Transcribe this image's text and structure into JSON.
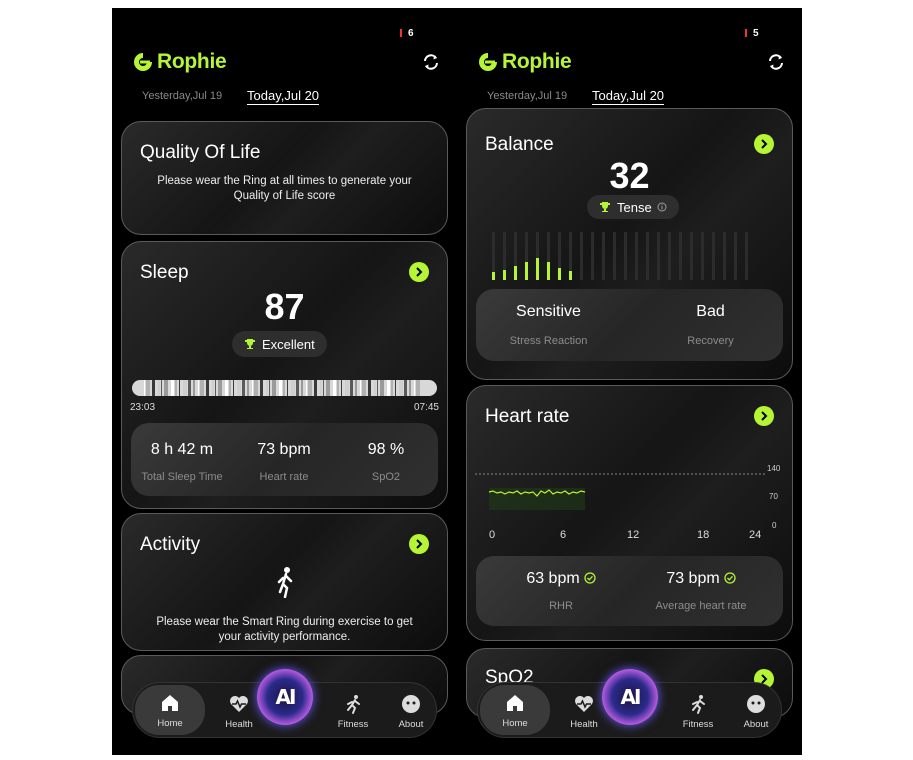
{
  "screens": [
    {
      "status_number": "6",
      "app_name": "Rophie",
      "date_yesterday": "Yesterday,Jul 19",
      "date_today": "Today,Jul 20",
      "quality": {
        "title": "Quality Of Life",
        "message_line1": "Please wear the Ring at all times to generate your",
        "message_line2": "Quality of Life score"
      },
      "sleep": {
        "title": "Sleep",
        "score": "87",
        "rating": "Excellent",
        "start_time": "23:03",
        "end_time": "07:45",
        "stats": [
          {
            "value": "8 h 42 m",
            "label": "Total Sleep Time"
          },
          {
            "value": "73 bpm",
            "label": "Heart rate"
          },
          {
            "value": "98 %",
            "label": "SpO2"
          }
        ]
      },
      "activity": {
        "title": "Activity",
        "message_line1": "Please wear the Smart Ring during exercise to get",
        "message_line2": "your activity performance."
      },
      "nav": {
        "home": "Home",
        "health": "Health",
        "ai": "AI",
        "fitness": "Fitness",
        "about": "About"
      }
    },
    {
      "status_number": "5",
      "app_name": "Rophie",
      "date_yesterday": "Yesterday,Jul 19",
      "date_today": "Today,Jul 20",
      "balance": {
        "title": "Balance",
        "score": "32",
        "rating": "Tense",
        "stats": [
          {
            "value": "Sensitive",
            "label": "Stress Reaction"
          },
          {
            "value": "Bad",
            "label": "Recovery"
          }
        ]
      },
      "heart_rate": {
        "title": "Heart rate",
        "x_ticks": [
          "0",
          "6",
          "12",
          "18",
          "24"
        ],
        "y_ticks": [
          "140",
          "70",
          "0"
        ],
        "stats": [
          {
            "value": "63 bpm",
            "label": "RHR"
          },
          {
            "value": "73 bpm",
            "label": "Average heart rate"
          }
        ]
      },
      "spo2": {
        "title": "SpO2"
      },
      "nav": {
        "home": "Home",
        "health": "Health",
        "ai": "AI",
        "fitness": "Fitness",
        "about": "About"
      }
    }
  ],
  "colors": {
    "accent": "#b5f536",
    "background": "#000000",
    "card": "#1a1a1a"
  },
  "icons": [
    "logo-mark-icon",
    "sync-icon",
    "chevron-right-icon",
    "trophy-icon",
    "runner-icon",
    "home-icon",
    "heart-pulse-icon",
    "fitness-runner-icon",
    "about-face-icon",
    "check-circle-icon",
    "info-icon"
  ]
}
